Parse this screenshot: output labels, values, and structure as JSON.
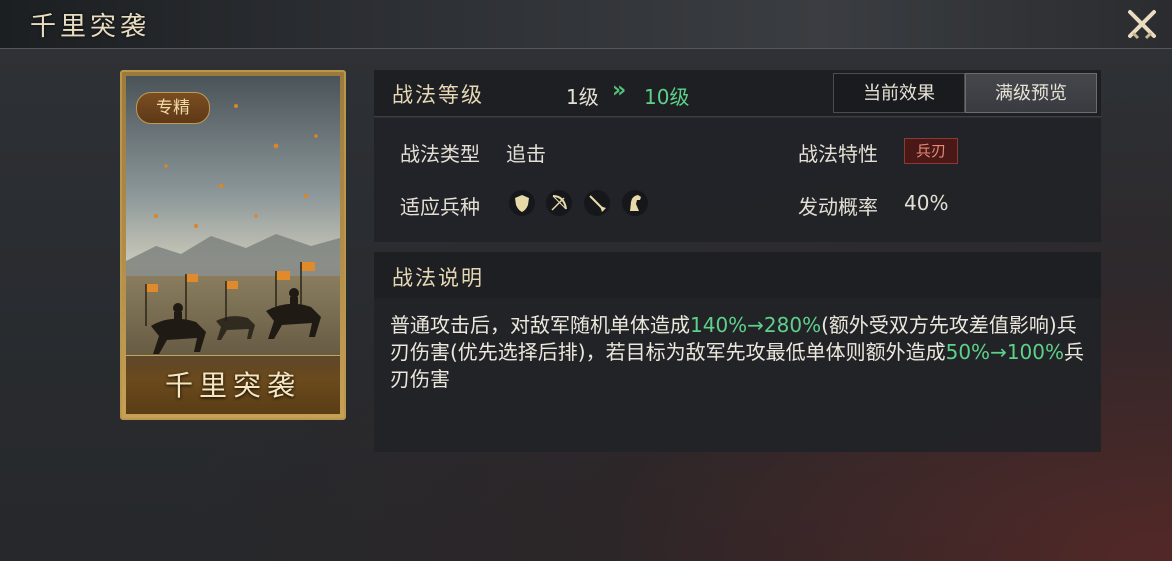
{
  "header": {
    "title": "千里突袭"
  },
  "card": {
    "badge": "专精",
    "name": "千里突袭"
  },
  "level": {
    "label": "战法等级",
    "from": "1级",
    "arrow": "»",
    "to": "10级",
    "tabs": {
      "current": "当前效果",
      "max": "满级预览"
    }
  },
  "attributes": {
    "type_label": "战法类型",
    "type_value": "追击",
    "trait_label": "战法特性",
    "trait_value": "兵刃",
    "troop_label": "适应兵种",
    "troop_icons": [
      "shield-icon",
      "bow-icon",
      "spear-icon",
      "horse-icon"
    ],
    "rate_label": "发动概率",
    "rate_value": "40%"
  },
  "description": {
    "title": "战法说明",
    "t1": "普通攻击后，对敌军随机单体造成",
    "h1": "140%→280%",
    "t2": "(额外受双方先攻差值影响)兵刃伤害(优先选择后排)，若目标为敌军先攻最低单体则额外造成",
    "h2": "50%→100%",
    "t3": "兵刃伤害"
  },
  "colors": {
    "highlight": "#5fd08a",
    "gold": "#b9974d",
    "trait": "#4a1816"
  }
}
